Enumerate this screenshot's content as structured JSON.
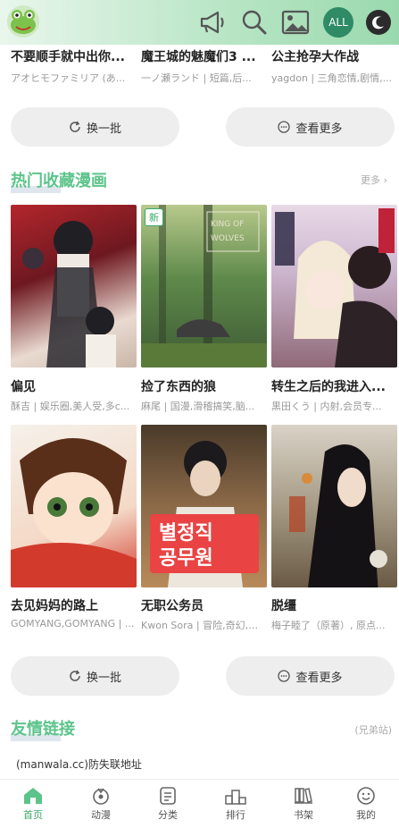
{
  "header": {
    "all_label": "ALL",
    "icons": [
      "frog-logo-icon",
      "megaphone-icon",
      "search-icon",
      "image-icon",
      "moon-icon"
    ]
  },
  "top_row": [
    {
      "title": "不要顺手就中出你...",
      "sub": "アオヒモファミリア (あ..."
    },
    {
      "title": "魔王城的魅魔们3 ...",
      "sub": "一ノ瀬ランド | 短篇,后..."
    },
    {
      "title": "公主抢孕大作战",
      "sub": "yagdon | 三角恋情,剧情,..."
    }
  ],
  "buttons": {
    "refresh": "换一批",
    "more": "查看更多"
  },
  "hot": {
    "title": "热门收藏漫画",
    "more": "更多",
    "items": [
      {
        "title": "偏见",
        "sub": "酥吉 | 娱乐圈,美人受,多c..."
      },
      {
        "title": "捡了东西的狼",
        "sub": "麻尾 | 国漫,滑稽搞笑,脑...",
        "badge": "新"
      },
      {
        "title": "转生之后的我进入...",
        "sub": "黒田くう | 内射,会员专..."
      },
      {
        "title": "去见妈妈的路上",
        "sub": "GOMYANG,GOMYANG | ..."
      },
      {
        "title": "无职公务员",
        "sub": "Kwon Sora | 冒险,奇幻,热..."
      },
      {
        "title": "脱缰",
        "sub": "梅子睦了（原著）, 原点..."
      }
    ]
  },
  "friends": {
    "title": "友情链接",
    "note": "(兄弟站)",
    "link": "(manwala.cc)防失联地址"
  },
  "nav": [
    {
      "label": "首页",
      "icon": "home-icon",
      "active": true
    },
    {
      "label": "动漫",
      "icon": "anime-icon"
    },
    {
      "label": "分类",
      "icon": "category-icon"
    },
    {
      "label": "排行",
      "icon": "rank-icon"
    },
    {
      "label": "书架",
      "icon": "bookshelf-icon"
    },
    {
      "label": "我的",
      "icon": "profile-icon"
    }
  ],
  "colors": {
    "accent": "#5cc48a",
    "header_end": "#9ad9ae",
    "pill_bg": "#eeeeee"
  }
}
